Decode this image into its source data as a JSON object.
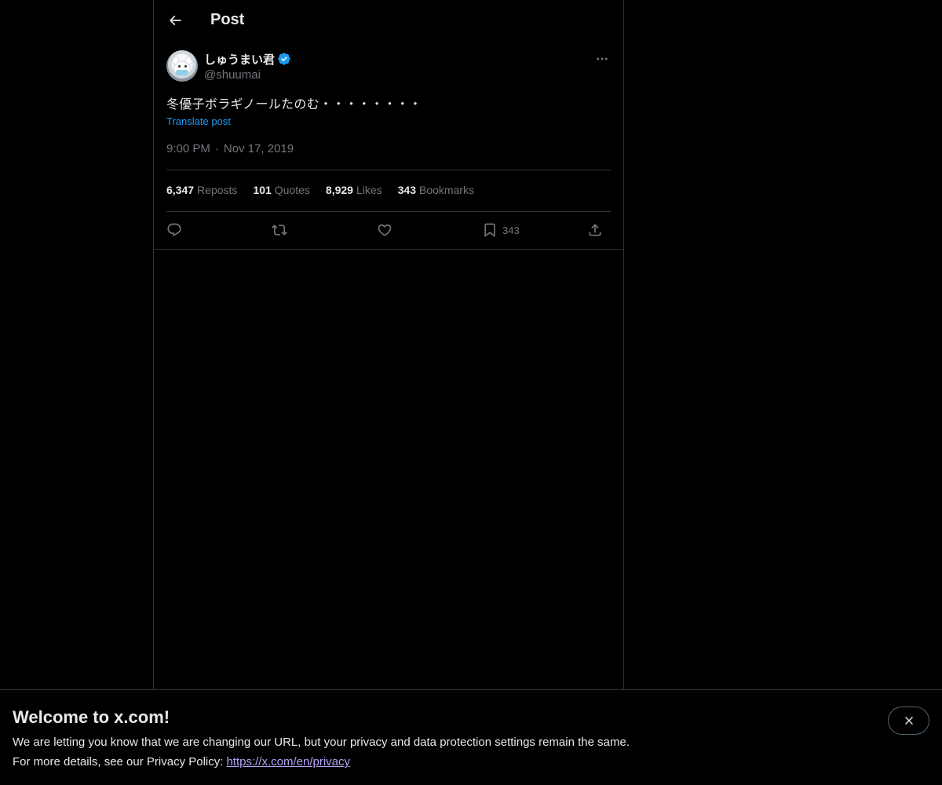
{
  "header": {
    "title": "Post",
    "back_icon": "arrow-left-icon"
  },
  "post": {
    "author": {
      "display_name": "しゅうまい君",
      "handle": "@shuumai",
      "verified": true,
      "verified_color": "#1d9bf0"
    },
    "text": "冬優子ボラギノールたのむ・・・・・・・・",
    "translate_label": "Translate post",
    "time": "9:00 PM",
    "separator": "·",
    "date": "Nov 17, 2019",
    "stats": [
      {
        "value": "6,347",
        "label": "Reposts"
      },
      {
        "value": "101",
        "label": "Quotes"
      },
      {
        "value": "8,929",
        "label": "Likes"
      },
      {
        "value": "343",
        "label": "Bookmarks"
      }
    ],
    "actions": {
      "reply_icon": "reply-icon",
      "repost_icon": "repost-icon",
      "like_icon": "heart-icon",
      "bookmark_icon": "bookmark-icon",
      "bookmark_count": "343",
      "share_icon": "share-icon"
    }
  },
  "banner": {
    "title": "Welcome to x.com!",
    "line1": "We are letting you know that we are changing our URL, but your privacy and data protection settings remain the same.",
    "line2_prefix": "For more details, see our Privacy Policy:",
    "link_text": "https://x.com/en/privacy",
    "link_color": "#b6a3f7",
    "close_icon": "close-icon"
  },
  "colors": {
    "background": "#000000",
    "text_primary": "#e7e9ea",
    "text_secondary": "#71767b",
    "accent": "#1d9bf0",
    "border": "#2f3336"
  }
}
